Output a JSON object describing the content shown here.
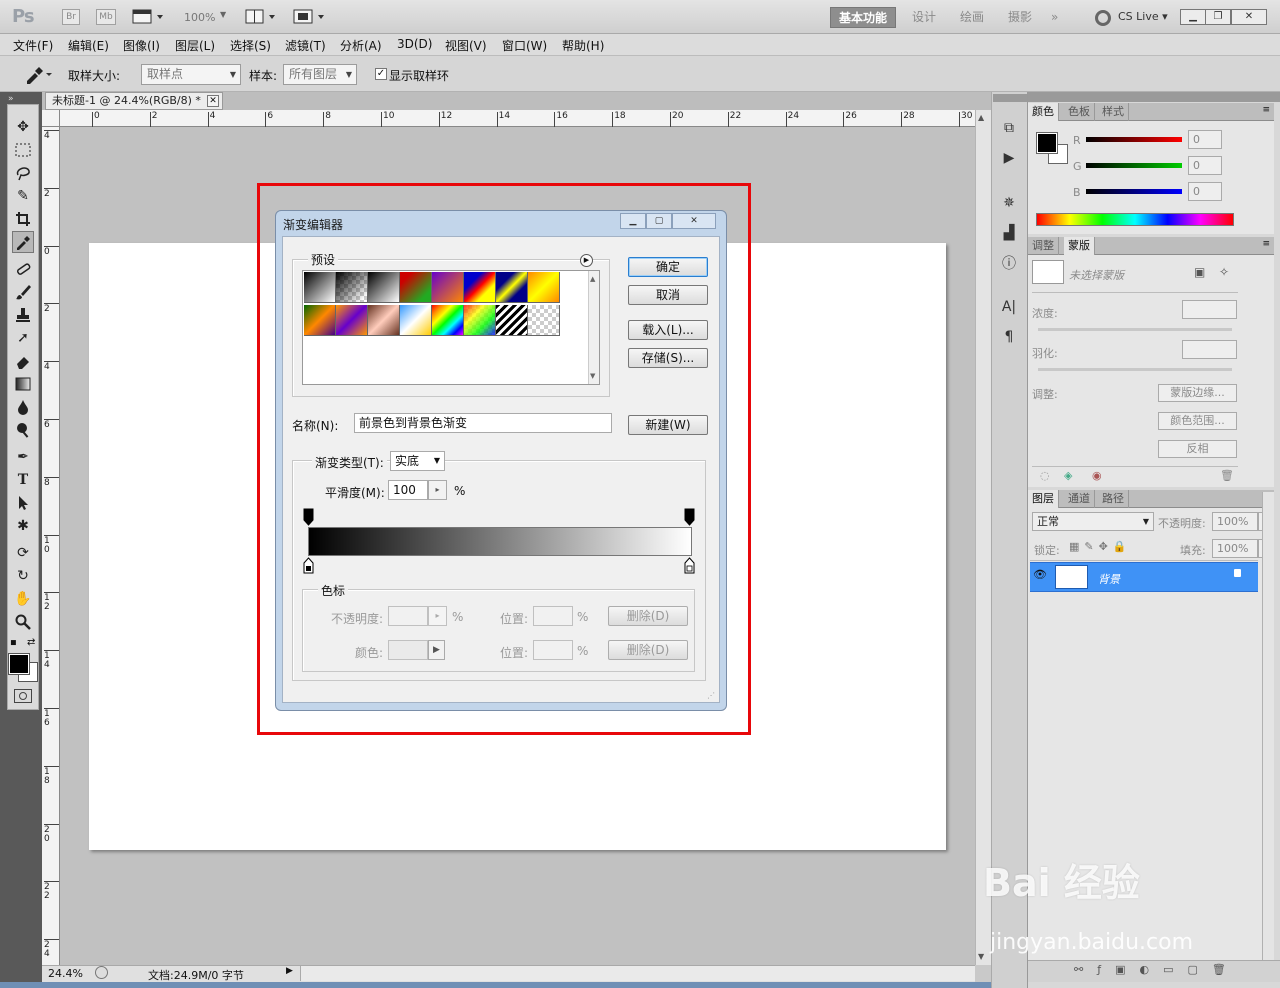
{
  "app": {
    "logo": "Ps",
    "bridge": "Br",
    "minibridge": "Mb",
    "zoom_readout": "100%",
    "workspaces": [
      "基本功能",
      "设计",
      "绘画",
      "摄影",
      "»"
    ],
    "cs_live": "CS Live"
  },
  "menubar": {
    "items": [
      "文件(F)",
      "编辑(E)",
      "图像(I)",
      "图层(L)",
      "选择(S)",
      "滤镜(T)",
      "分析(A)",
      "3D(D)",
      "视图(V)",
      "窗口(W)",
      "帮助(H)"
    ]
  },
  "options": {
    "sample_size_label": "取样大小:",
    "sample_size_value": "取样点",
    "sample_label": "样本:",
    "sample_value": "所有图层",
    "show_ring_label": "显示取样环"
  },
  "document": {
    "tab_title": "未标题-1 @ 24.4%(RGB/8) *",
    "ruler_h": [
      "0",
      "2",
      "4",
      "6",
      "8",
      "10",
      "12",
      "14",
      "16",
      "18",
      "20",
      "22",
      "24",
      "26",
      "28",
      "30"
    ],
    "ruler_v": [
      "4",
      "2",
      "0",
      "2",
      "4",
      "6",
      "8",
      "1 0",
      "1 2",
      "1 4",
      "1 6",
      "1 8",
      "2 0",
      "2 2",
      "2 4"
    ],
    "zoom": "24.4%",
    "doc_info": "文档:24.9M/0 字节"
  },
  "dialog": {
    "title": "渐变编辑器",
    "presets_label": "预设",
    "ok": "确定",
    "cancel": "取消",
    "load": "载入(L)...",
    "save": "存储(S)...",
    "name_label": "名称(N):",
    "name_value": "前景色到背景色渐变",
    "new_btn": "新建(W)",
    "type_label": "渐变类型(T):",
    "type_value": "实底",
    "smooth_label": "平滑度(M):",
    "smooth_value": "100",
    "percent": "%",
    "stops_label": "色标",
    "opacity_label": "不透明度:",
    "color_label": "颜色:",
    "location_label": "位置:",
    "delete_btn": "删除(D)"
  },
  "panels": {
    "color_tabs": [
      "颜色",
      "色板",
      "样式"
    ],
    "color_channels": [
      {
        "label": "R",
        "value": "0"
      },
      {
        "label": "G",
        "value": "0"
      },
      {
        "label": "B",
        "value": "0"
      }
    ],
    "mask_tabs": [
      "调整",
      "蒙版"
    ],
    "mask_title": "未选择蒙版",
    "density_label": "浓度:",
    "feather_label": "羽化:",
    "refine_label": "调整:",
    "mask_edge_btn": "蒙版边缘...",
    "color_range_btn": "颜色范围...",
    "invert_btn": "反相",
    "layer_tabs": [
      "图层",
      "通道",
      "路径"
    ],
    "blend_mode": "正常",
    "opacity_label": "不透明度:",
    "opacity_value": "100%",
    "lock_label": "锁定:",
    "fill_label": "填充:",
    "fill_value": "100%",
    "layer_name": "背景"
  },
  "watermark": {
    "brand": "Bai 经验",
    "url": "jingyan.baidu.com"
  },
  "colors": {
    "highlight_box": "#e8070a",
    "layer_selected": "#3f92f6"
  }
}
